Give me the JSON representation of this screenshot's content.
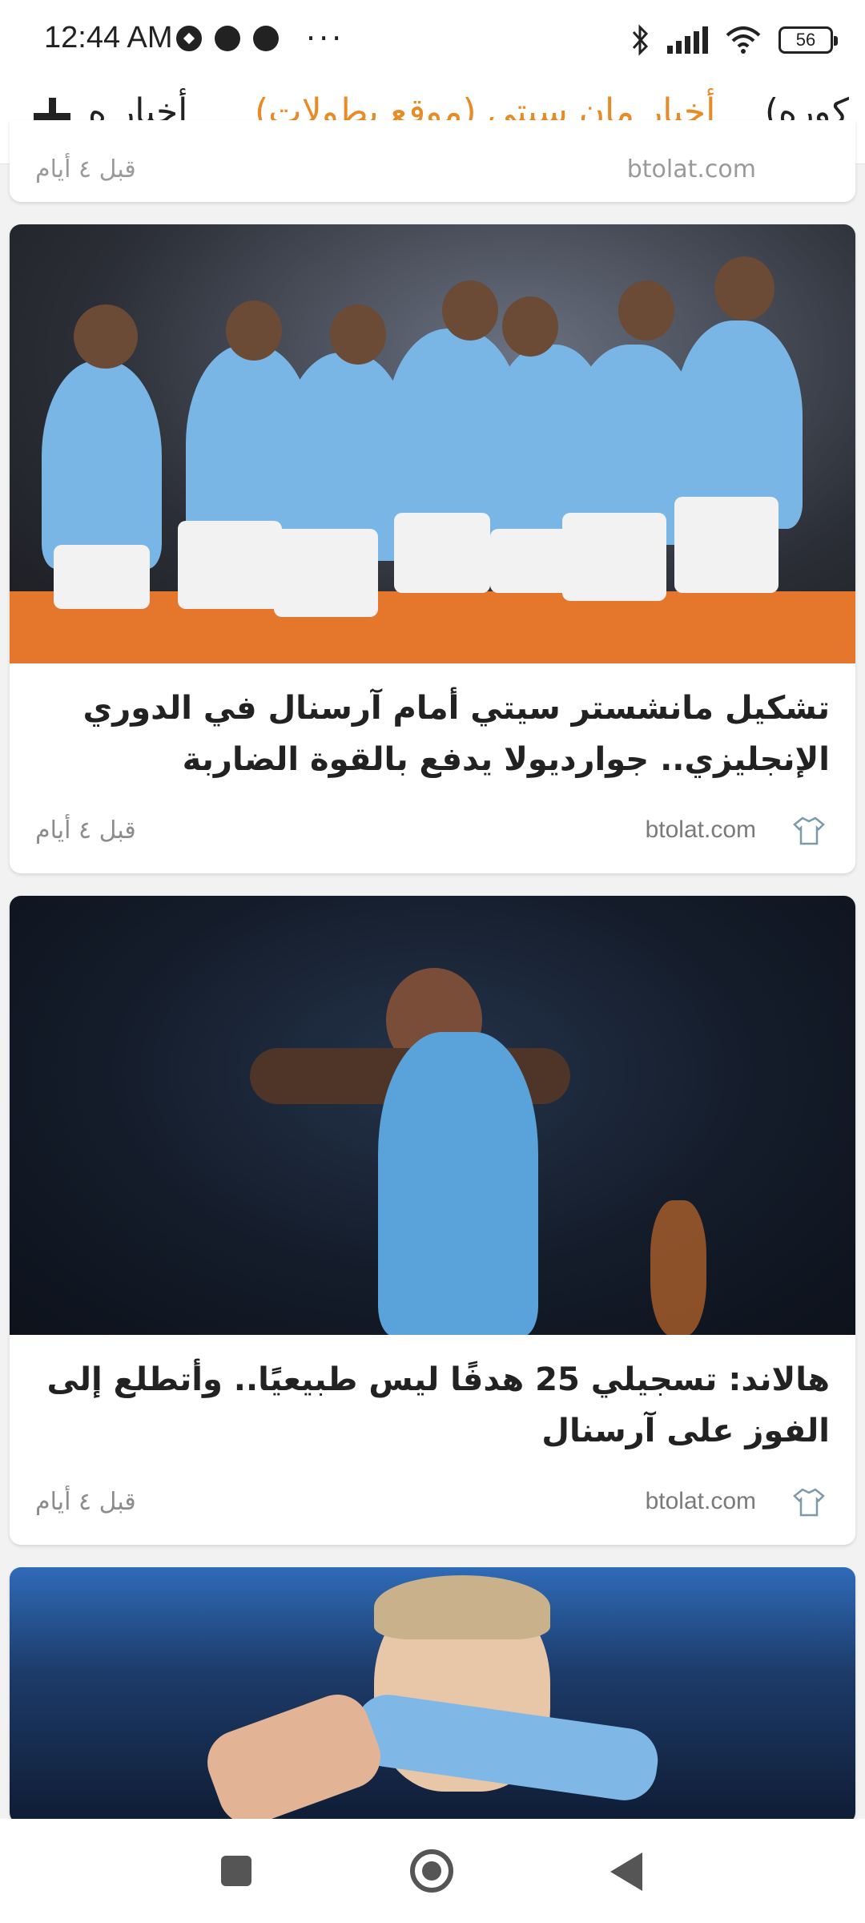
{
  "status_bar": {
    "time": "12:44 AM",
    "more": "···",
    "battery": "56"
  },
  "tabs": {
    "left_label": "أخبار ه",
    "active_label": "أخبار مان سيتي (موقع بطولات)",
    "right_label": "كوره)",
    "accent_color": "#e88a26"
  },
  "feed": {
    "partial": {
      "source": "btolat.com",
      "time": "قبل ٤ أيام"
    },
    "articles": [
      {
        "title": "تشكيل مانشستر سيتي أمام آرسنال في الدوري الإنجليزي.. جوارديولا يدفع بالقوة الضاربة",
        "source": "btolat.com",
        "time": "قبل ٤ أيام",
        "icon": "shirt-icon"
      },
      {
        "title": "هالاند: تسجيلي 25 هدفًا ليس طبيعيًا.. وأتطلع إلى الفوز على آرسنال",
        "source": "btolat.com",
        "time": "قبل ٤ أيام",
        "icon": "shirt-icon"
      }
    ]
  },
  "nav": {
    "recents_icon": "square-icon",
    "home_icon": "home-circle-icon",
    "back_icon": "back-triangle-icon"
  }
}
